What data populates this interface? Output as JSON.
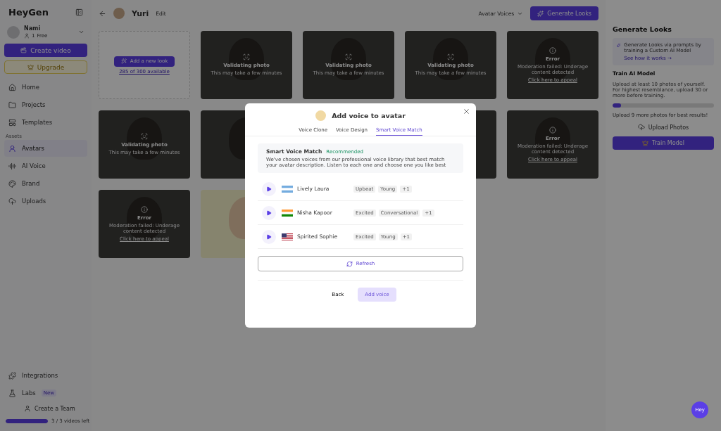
{
  "sidebar": {
    "logo": "HeyGen",
    "account": {
      "name": "Nami",
      "plan": "Free",
      "members": "1"
    },
    "create_button": "Create video",
    "upgrade_button": "Upgrade",
    "items": [
      {
        "label": "Home",
        "selected": false
      },
      {
        "label": "Projects",
        "selected": false
      },
      {
        "label": "Templates",
        "selected": false
      }
    ],
    "section": "Assets",
    "asset_items": [
      {
        "label": "Avatars",
        "selected": true
      },
      {
        "label": "AI Voice",
        "selected": false
      },
      {
        "label": "Brand",
        "selected": false
      },
      {
        "label": "Uploads",
        "selected": false
      }
    ],
    "bottom_items": [
      {
        "label": "Integrations"
      },
      {
        "label": "Labs",
        "badge": "New"
      }
    ],
    "team": "Create a Team",
    "quota": {
      "level": 1,
      "text": "3 / 3 videos left"
    }
  },
  "header": {
    "name": "Yuri",
    "edit": "Edit",
    "voices_dropdown": "Avatar Voices",
    "generate_button": "Generate Looks"
  },
  "cards": [
    {
      "kind": "add",
      "button": "Add a new look",
      "note": "285 of 300 available"
    },
    {
      "kind": "validating",
      "title": "Validating photo",
      "note": "This may take a few minutes"
    },
    {
      "kind": "validating",
      "title": "Validating photo",
      "note": "This may take a few minutes"
    },
    {
      "kind": "validating",
      "title": "Validating photo",
      "note": "This may take a few minutes"
    },
    {
      "kind": "error",
      "title": "Error",
      "note": "Moderation failed: Underage content detected",
      "link": "Click here to appeal"
    },
    {
      "kind": "validating",
      "title": "Validating photo",
      "note": "This may take a few minutes"
    },
    {
      "kind": "blank"
    },
    {
      "kind": "blank"
    },
    {
      "kind": "blank"
    },
    {
      "kind": "error",
      "title": "Error",
      "note": "Moderation failed: Underage content detected",
      "link": "Click here to appeal"
    },
    {
      "kind": "error",
      "title": "Error",
      "note": "Moderation failed: Underage content detected",
      "link": "Click here to appeal"
    },
    {
      "kind": "photo"
    }
  ],
  "right_panel": {
    "title": "Generate Looks",
    "info": "Generate Looks via prompts by training a Custom AI Model",
    "info_link": "See how it works →",
    "train_title": "Train AI Model",
    "train_text": "Upload at least 10 photos of yourself. For highest resemblance, upload 30 or more before training.",
    "progress": {
      "level": 0.08
    },
    "progress_note": "Upload 9 more photos for best results!",
    "upload_button": "Upload Photos",
    "train_button": "Train Model"
  },
  "modal": {
    "title": "Add voice to avatar",
    "tabs": [
      {
        "label": "Voice Clone",
        "selected": false
      },
      {
        "label": "Voice Design",
        "selected": false
      },
      {
        "label": "Smart Voice Match",
        "selected": true
      }
    ],
    "info_title": "Smart Voice Match",
    "info_badge": "Recommended",
    "info_text": "We've chosen voices from our professional voice library that best match your avatar description. Listen to each one and choose one you like best",
    "voices": [
      {
        "name": "Lively Laura",
        "tags": [
          "Upbeat",
          "Young",
          "+1"
        ]
      },
      {
        "name": "Nisha Kapoor",
        "tags": [
          "Excited",
          "Conversational",
          "+1"
        ]
      },
      {
        "name": "Spirited Sophie",
        "tags": [
          "Excited",
          "Young",
          "+1"
        ]
      }
    ],
    "refresh_button": "Refresh",
    "back_button": "Back",
    "confirm_button": "Add voice"
  },
  "chat_button": "Hey"
}
